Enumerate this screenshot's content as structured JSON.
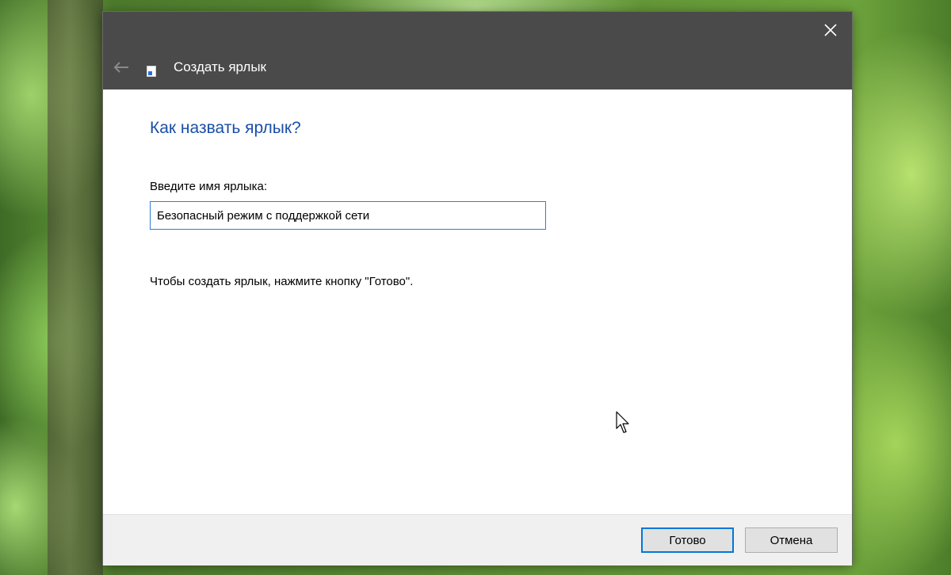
{
  "window": {
    "title": "Создать ярлык",
    "back_icon": "back-arrow-icon",
    "close_icon": "close-icon"
  },
  "main": {
    "heading": "Как назвать ярлык?",
    "name_label": "Введите имя ярлыка:",
    "name_value": "Безопасный режим с поддержкой сети",
    "hint": "Чтобы создать ярлык, нажмите кнопку \"Готово\"."
  },
  "footer": {
    "finish_label": "Готово",
    "cancel_label": "Отмена"
  },
  "colors": {
    "titlebar": "#4a4a4a",
    "heading": "#1a4ea8",
    "accent": "#0078d7"
  }
}
